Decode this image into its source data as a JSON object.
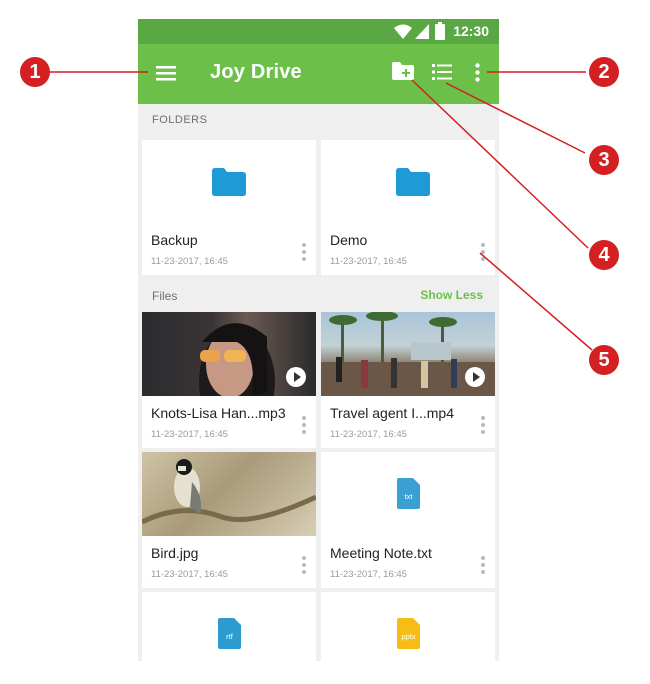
{
  "status": {
    "time": "12:30"
  },
  "appbar": {
    "title": "Joy Drive"
  },
  "sections": {
    "folders": "FOLDERS",
    "files": "Files",
    "show_less": "Show Less"
  },
  "folders": [
    {
      "name": "Backup",
      "date": "11-23-2017, 16:45"
    },
    {
      "name": "Demo",
      "date": "11-23-2017, 16:45"
    }
  ],
  "files": [
    {
      "name": "Knots-Lisa Han...mp3",
      "date": "11-23-2017, 16:45",
      "kind": "video-thumbnail"
    },
    {
      "name": "Travel agent I...mp4",
      "date": "11-23-2017, 16:45",
      "kind": "video-thumbnail"
    },
    {
      "name": "Bird.jpg",
      "date": "11-23-2017, 16:45",
      "kind": "image-thumbnail"
    },
    {
      "name": "Meeting Note.txt",
      "date": "11-23-2017, 16:45",
      "kind": "txt",
      "badge": "txt"
    },
    {
      "kind": "rtf",
      "badge": "rtf"
    },
    {
      "kind": "pptx",
      "badge": "pptx"
    }
  ],
  "colors": {
    "appbar": "#6cc04a",
    "statusbar": "#5aa844",
    "folder": "#1e9ad6",
    "callout": "#d41f23",
    "rtf": "#2e9bd0",
    "txt": "#3a9fd2",
    "pptx": "#f6be15"
  },
  "callouts": [
    "1",
    "2",
    "3",
    "4",
    "5"
  ]
}
